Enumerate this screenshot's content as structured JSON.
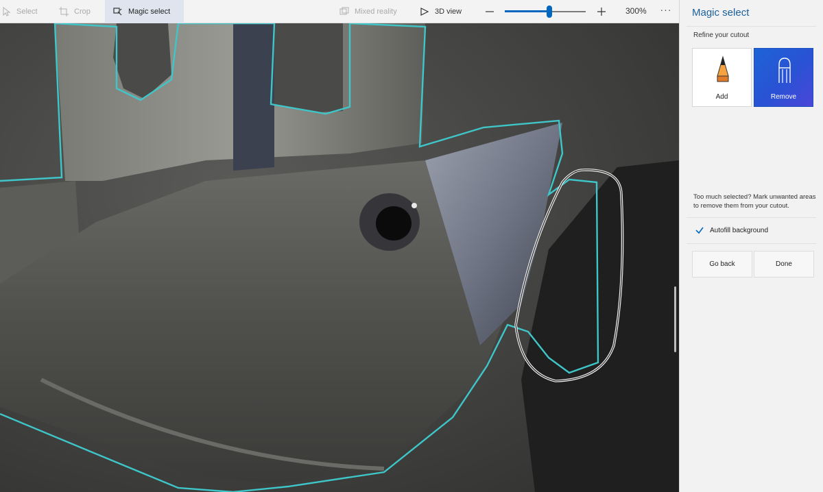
{
  "toolbar": {
    "select_label": "Select",
    "crop_label": "Crop",
    "magic_select_label": "Magic select",
    "mixed_reality_label": "Mixed reality",
    "view3d_label": "3D view",
    "zoom_value": "300%",
    "zoom_level_fraction": 0.55,
    "more_label": "···"
  },
  "panel": {
    "title": "Magic select",
    "subtitle": "Refine your cutout",
    "add_label": "Add",
    "remove_label": "Remove",
    "selected_tool": "remove",
    "hint": "Too much selected? Mark unwanted areas to remove them from your cutout.",
    "autofill_label": "Autofill background",
    "autofill_checked": true,
    "go_back_label": "Go back",
    "done_label": "Done"
  },
  "colors": {
    "accent": "#0067c0",
    "selection_outline": "#3fc6c9",
    "remove_button": "#2a52d4"
  }
}
